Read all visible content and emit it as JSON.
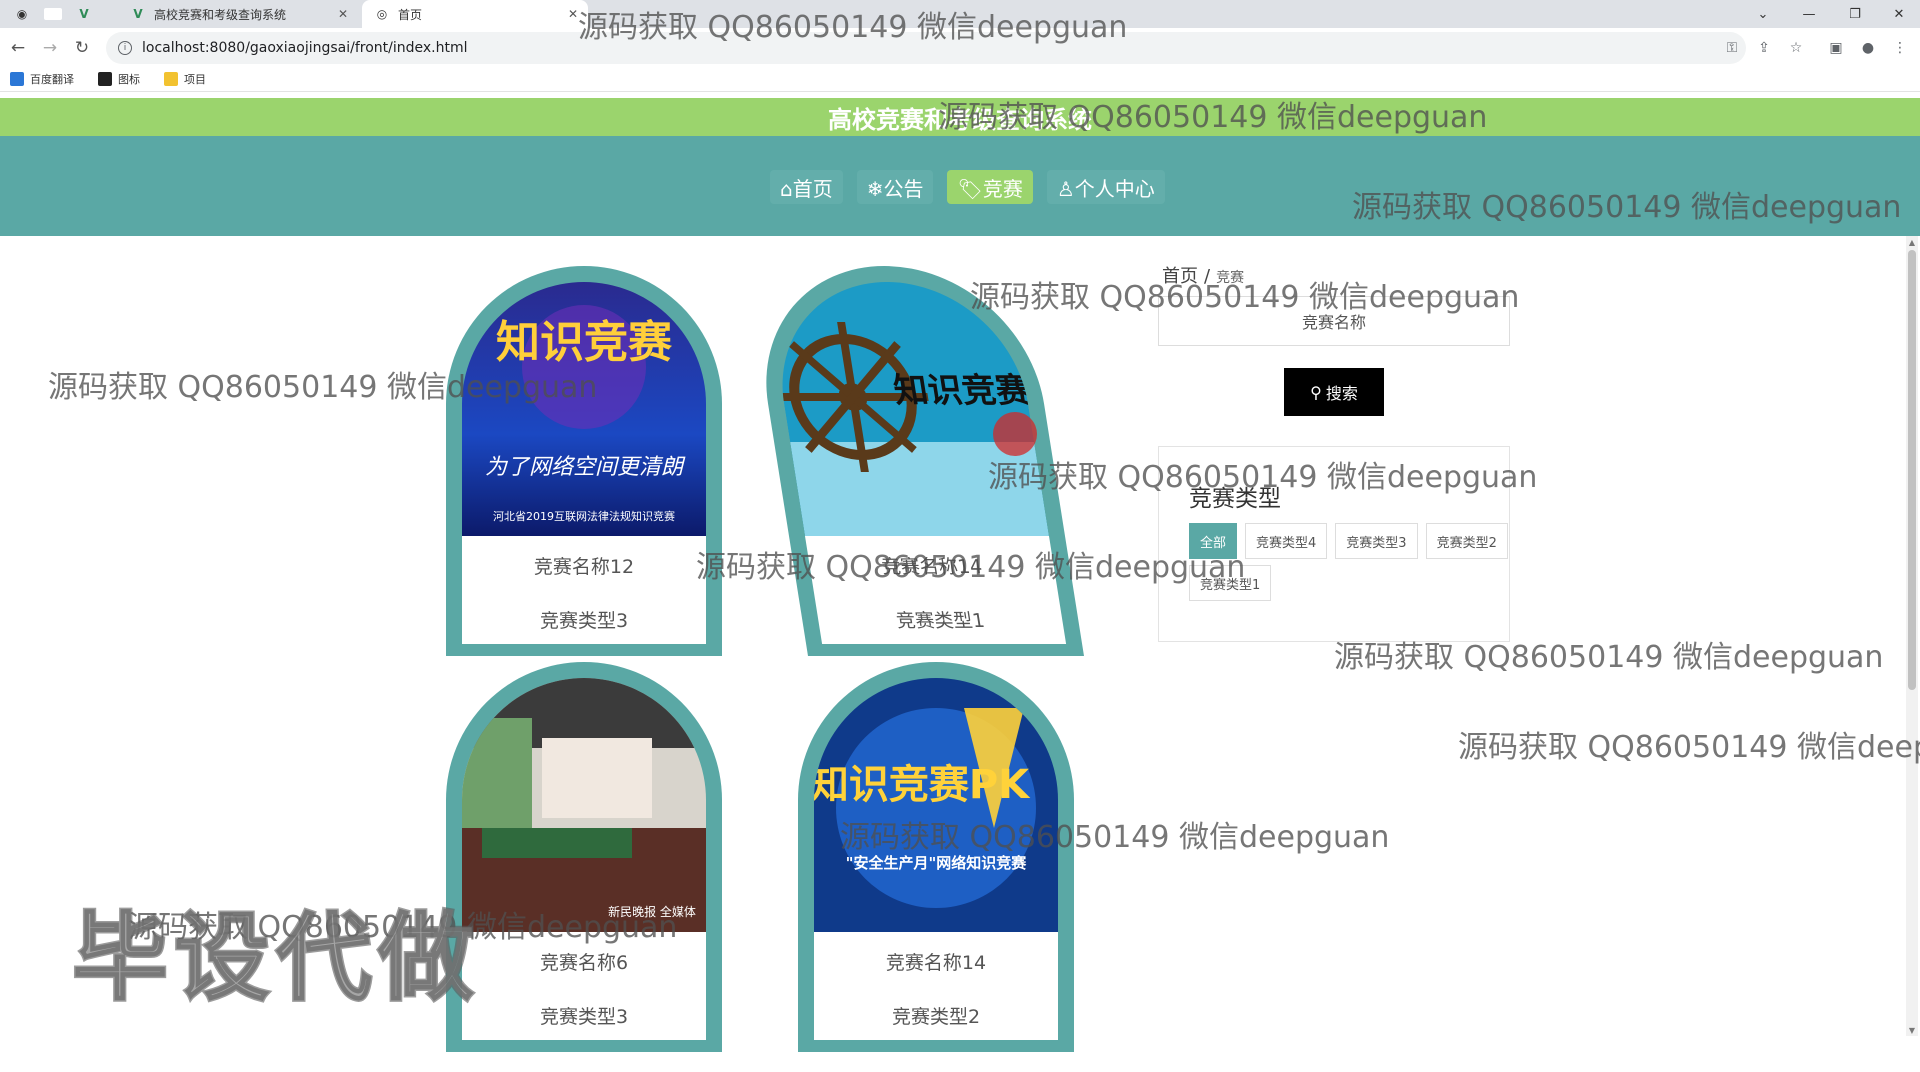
{
  "browser": {
    "tabs": [
      {
        "label": ""
      },
      {
        "label": "高校竞赛和考级查询系统"
      },
      {
        "label": "首页"
      }
    ],
    "url": "localhost:8080/gaoxiaojingsai/front/index.html",
    "bookmarks": [
      "百度翻译",
      "图标",
      "项目"
    ]
  },
  "site": {
    "title": "高校竞赛和考级查询系统",
    "nav": [
      {
        "label": "⌂首页"
      },
      {
        "label": "❄公告"
      },
      {
        "label": "🏷竞赛"
      },
      {
        "label": "♙个人中心"
      }
    ]
  },
  "cards": [
    {
      "name": "竞赛名称12",
      "type": "竞赛类型3",
      "image_text": "知识竞赛",
      "image_caption": "为了网络空间更清朗",
      "image_footer": "河北省2019互联网法律法规知识竞赛"
    },
    {
      "name": "竞赛名称14",
      "type": "竞赛类型1",
      "image_text": "知识竞赛"
    },
    {
      "name": "竞赛名称6",
      "type": "竞赛类型3",
      "image_footer": "新民晚报 全媒体"
    },
    {
      "name": "竞赛名称14",
      "type": "竞赛类型2",
      "image_text": "知识竞赛PK",
      "image_caption": "\"安全生产月\"网络知识竞赛"
    }
  ],
  "sidebar": {
    "breadcrumb_home": "首页",
    "breadcrumb_sep": "/",
    "breadcrumb_current": "竞赛",
    "search_placeholder": "竞赛名称",
    "search_button": "搜索",
    "type_title": "竞赛类型",
    "types": [
      "全部",
      "竞赛类型4",
      "竞赛类型3",
      "竞赛类型2",
      "竞赛类型1"
    ]
  },
  "watermark": "源码获取 QQ86050149 微信deepguan",
  "big_watermark": "毕设代做",
  "colors": {
    "teal": "#5aa8a5",
    "green": "#9bd46d",
    "black_button": "#000000"
  }
}
